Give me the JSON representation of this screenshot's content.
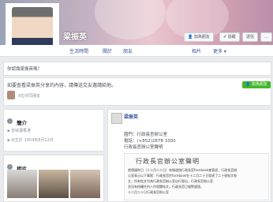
{
  "profile": {
    "name": "梁振英",
    "add_friend": "加為朋友",
    "follow": "追蹤",
    "message": "送信"
  },
  "nav": {
    "items": [
      "生活時間",
      "關於",
      "朋友",
      "相片",
      "更多"
    ]
  },
  "visitor_prompt": {
    "text": "你認識梁振英嗎？"
  },
  "share": {
    "text": "如要查看梁振英分享的內容，請傳送交友邀請給他。",
    "button": "加為朋友",
    "line2": "8位共同朋友"
  },
  "intro": {
    "title": "簡介",
    "work": "曾就讀香港",
    "born": "出生於 1954年8月12日"
  },
  "photos": {
    "title": "相片"
  },
  "post": {
    "author": "梁振英",
    "time": "",
    "line1": "國門：行政長官辦公室",
    "line2": "電話：(+852)2878 3300",
    "line3": "行政長官辦公室聲明",
    "statement_title": "行政長官辦公室聲明",
    "body1": "就傳媒昨日（十二月二十日）有報道指行政長官facebook被冒認，行政長官辦",
    "body2": "公室表示以下事實：行政長官於facebook在十二月二十日發表了二十個帖文帖",
    "body3": "文，所有帖文均為行政長官辦公室自行發出，行政長官辦公室",
    "body4": "並沒有授權任何人作相關帖文。行政長官已報警處理。",
    "body5": "十二月二十日行政長官辦公室"
  }
}
